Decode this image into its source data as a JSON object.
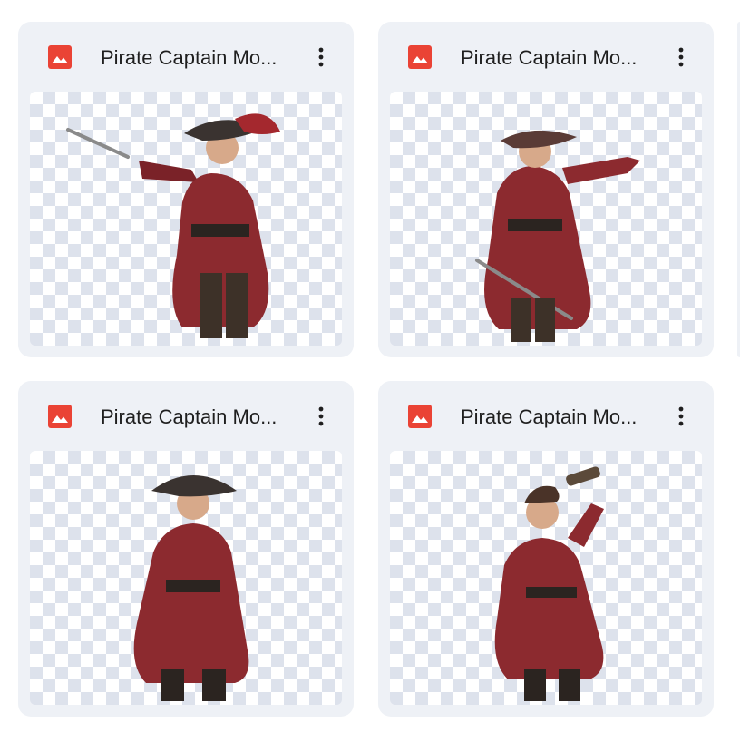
{
  "files": [
    {
      "name": "Pirate Captain Mo...",
      "icon": "image-file-icon",
      "menu_icon": "more-vert-icon",
      "subject": "pointing-sword"
    },
    {
      "name": "Pirate Captain Mo...",
      "icon": "image-file-icon",
      "menu_icon": "more-vert-icon",
      "subject": "pointing-finger"
    },
    {
      "name": "Pirate Captain Mo...",
      "icon": "image-file-icon",
      "menu_icon": "more-vert-icon",
      "subject": "standing"
    },
    {
      "name": "Pirate Captain Mo...",
      "icon": "image-file-icon",
      "menu_icon": "more-vert-icon",
      "subject": "telescope"
    }
  ],
  "colors": {
    "card_bg": "#eef1f6",
    "icon_red": "#ea4335",
    "text": "#1f1f1f",
    "checker": "#dde2ec",
    "coat": "#8c2a2f"
  }
}
